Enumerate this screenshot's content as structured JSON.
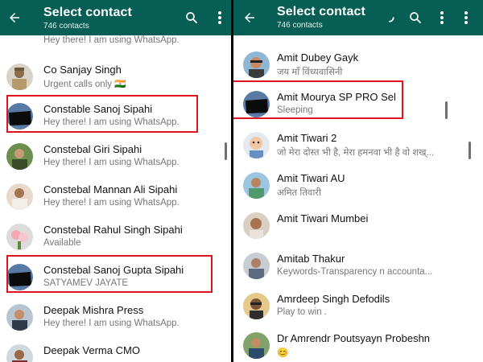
{
  "left": {
    "title": "Select contact",
    "subtitle": "746 contacts",
    "partial_status": "Hey there! I am using WhatsApp.",
    "contacts": [
      {
        "name": "Co Sanjay Singh",
        "status": "Urgent calls only 🇮🇳"
      },
      {
        "name": "Constable Sanoj Sipahi",
        "status": "Hey there! I am using WhatsApp."
      },
      {
        "name": "Constebal Giri Sipahi",
        "status": "Hey there! I am using WhatsApp."
      },
      {
        "name": "Constebal Mannan Ali Sipahi",
        "status": "Hey there! I am using WhatsApp."
      },
      {
        "name": "Constebal Rahul Singh Sipahi",
        "status": "Available"
      },
      {
        "name": "Constebal Sanoj Gupta Sipahi",
        "status": "SATYAMEV JAYATE"
      },
      {
        "name": "Deepak Mishra Press",
        "status": "Hey there! I am using WhatsApp."
      },
      {
        "name": "Deepak Verma CMO",
        "status": ""
      }
    ]
  },
  "right": {
    "title": "Select contact",
    "subtitle": "746 contacts",
    "contacts": [
      {
        "name": "Amit Dubey Gayk",
        "status": "जय माँ विंध्यवासिनी"
      },
      {
        "name": "Amit Mourya SP PRO Sel",
        "status": "Sleeping"
      },
      {
        "name": "Amit Tiwari 2",
        "status": "जो मेरा दोस्त भी है, मेरा हमनवा भी है वो शख्..."
      },
      {
        "name": "Amit Tiwari AU",
        "status": "अमित तिवारी"
      },
      {
        "name": "Amit Tiwari Mumbei",
        "status": ""
      },
      {
        "name": "Amitab Thakur",
        "status": "Keywords-Transparency n accounta..."
      },
      {
        "name": "Amrdeep Singh Defodils",
        "status": "Play  to win ."
      },
      {
        "name": "Dr Amrendr Poutsyayn Probeshn",
        "status": "😊"
      }
    ]
  },
  "colors": {
    "appbar": "#075e54",
    "highlight": "#e0141e"
  },
  "icons": [
    "back-arrow-icon",
    "search-icon",
    "more-vert-icon",
    "loading-spinner-icon"
  ]
}
